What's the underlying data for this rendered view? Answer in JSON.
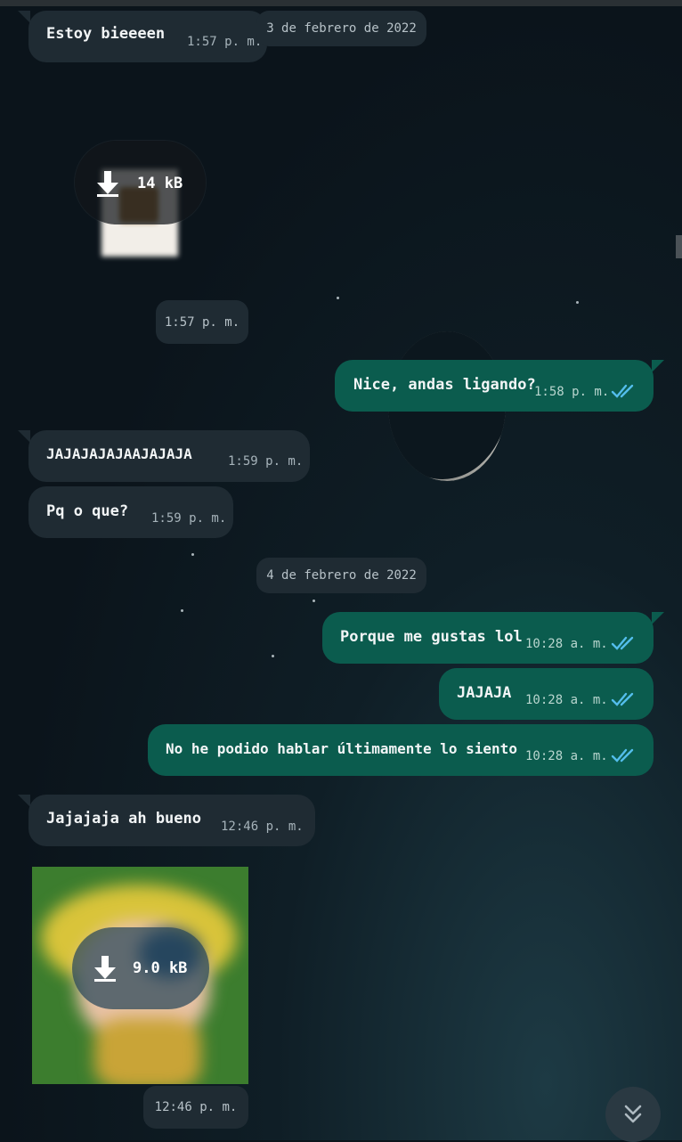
{
  "chat": {
    "dates": [
      "3 de febrero de 2022",
      "4 de febrero de 2022"
    ],
    "messages": [
      {
        "text": "Estoy bieeeen",
        "time": "1:57 p. m."
      },
      {
        "media_size": "14 kB",
        "time": "1:57 p. m."
      },
      {
        "text": "Nice, andas ligando?",
        "time": "1:58 p. m."
      },
      {
        "text": "JAJAJAJAJAAJAJAJA",
        "time": "1:59 p. m."
      },
      {
        "text": "Pq o que?",
        "time": "1:59 p. m."
      },
      {
        "text": "Porque me gustas lol",
        "time": "10:28 a. m."
      },
      {
        "text": "JAJAJA",
        "time": "10:28 a. m."
      },
      {
        "text": "No he podido hablar últimamente lo siento",
        "time": "10:28 a. m."
      },
      {
        "text": "Jajajaja ah bueno",
        "time": "12:46 p. m."
      },
      {
        "media_size": "9.0 kB",
        "time": "12:46 p. m."
      }
    ]
  },
  "icons": {
    "read_receipt": "double-check-icon",
    "download": "download-arrow-icon",
    "scroll_down": "double-chevron-down-icon"
  },
  "colors": {
    "incoming_bubble": "#1f2b33",
    "outgoing_bubble": "#0b5c4e",
    "read_tick": "#53bdeb"
  }
}
